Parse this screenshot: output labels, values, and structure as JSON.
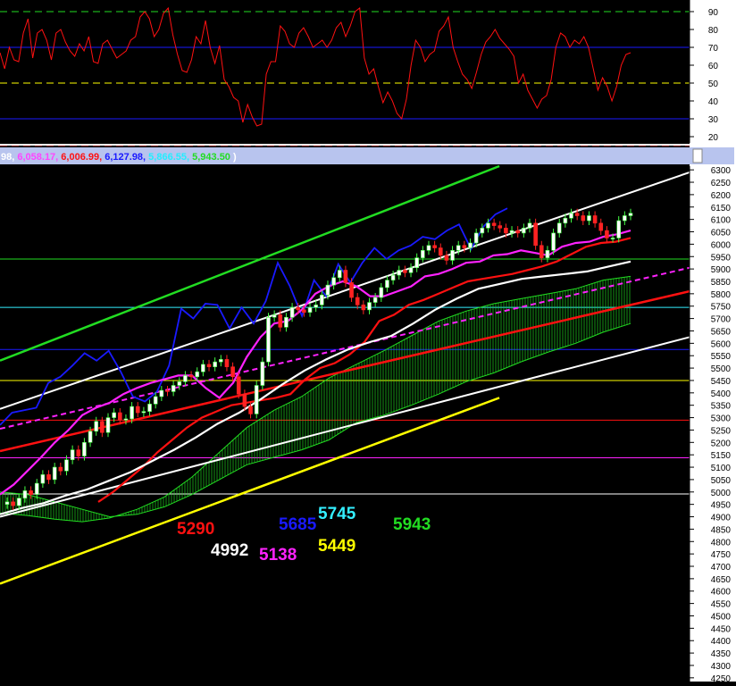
{
  "colors": {
    "background": "#000000",
    "axis_panel": "#ffffff",
    "legend_bar": "#b8c4ee",
    "green": "#22dd22",
    "white": "#ffffff",
    "red": "#ff1111",
    "magenta": "#ff22ff",
    "blue": "#1a1aff",
    "cyan": "#33eeff",
    "yellow": "#ffff00"
  },
  "legend_bar": {
    "open_paren": "(",
    "close_paren": ")",
    "values": [
      {
        "text": "98,",
        "color": "#ffffff"
      },
      {
        "text": "6,058.17,",
        "color": "#ff44ff"
      },
      {
        "text": "6,006.99,",
        "color": "#ff1111"
      },
      {
        "text": "6,127.98,",
        "color": "#1a1aff"
      },
      {
        "text": "5,866.55,",
        "color": "#22eeff"
      },
      {
        "text": "5,943.50",
        "color": "#22dd22"
      }
    ]
  },
  "chart_data": [
    {
      "type": "line",
      "panel": "oscillator",
      "y_ticks": [
        90,
        80,
        70,
        60,
        50,
        40,
        30,
        20
      ],
      "ylim": [
        15,
        95
      ],
      "reference_lines": [
        {
          "value": 90,
          "color": "#22dd22",
          "style": "dashed"
        },
        {
          "value": 70,
          "color": "#1a1aff",
          "style": "solid"
        },
        {
          "value": 50,
          "color": "#ffff00",
          "style": "dashed"
        },
        {
          "value": 30,
          "color": "#1a1aff",
          "style": "solid"
        },
        {
          "value": 15,
          "color": "#ff1111",
          "style": "dashed"
        }
      ],
      "series": [
        {
          "color": "#ff1111",
          "values": [
            67,
            58,
            70,
            63,
            62,
            78,
            86,
            64,
            78,
            80,
            74,
            63,
            78,
            80,
            73,
            68,
            65,
            72,
            68,
            76,
            62,
            61,
            72,
            74,
            69,
            64,
            66,
            68,
            74,
            76,
            87,
            90,
            86,
            76,
            80,
            89,
            92,
            77,
            66,
            57,
            56,
            63,
            76,
            72,
            85,
            70,
            61,
            71,
            52,
            48,
            42,
            40,
            28,
            38,
            31,
            26,
            27,
            55,
            62,
            62,
            82,
            79,
            72,
            70,
            78,
            81,
            76,
            70,
            72,
            74,
            70,
            74,
            81,
            84,
            76,
            82,
            90,
            92,
            64,
            55,
            58,
            48,
            39,
            45,
            40,
            33,
            30,
            41,
            60,
            74,
            70,
            62,
            66,
            68,
            79,
            82,
            87,
            70,
            62,
            55,
            52,
            47,
            56,
            66,
            73,
            76,
            80,
            75,
            72,
            69,
            65,
            50,
            55,
            46,
            41,
            36,
            41,
            43,
            52,
            70,
            78,
            76,
            70,
            74,
            72,
            76,
            70,
            58,
            46,
            53,
            48,
            40,
            48,
            60,
            66,
            67
          ]
        }
      ]
    },
    {
      "type": "line",
      "panel": "price",
      "y_ticks": [
        6300,
        6250,
        6200,
        6150,
        6100,
        6050,
        6000,
        5950,
        5900,
        5850,
        5800,
        5750,
        5700,
        5650,
        5600,
        5550,
        5500,
        5450,
        5400,
        5350,
        5300,
        5250,
        5200,
        5150,
        5100,
        5050,
        5000,
        4950,
        4900,
        4850,
        4800,
        4750,
        4700,
        4650,
        4600,
        4550,
        4500,
        4450,
        4400,
        4350,
        4300,
        4250
      ],
      "ylim": [
        4235,
        6315
      ],
      "price_samples": [
        4960,
        4945,
        4975,
        5005,
        4990,
        5035,
        5070,
        5050,
        5100,
        5085,
        5130,
        5170,
        5145,
        5200,
        5245,
        5285,
        5240,
        5300,
        5320,
        5290,
        5295,
        5345,
        5320,
        5325,
        5355,
        5385,
        5410,
        5405,
        5430,
        5445,
        5470,
        5465,
        5485,
        5515,
        5505,
        5525,
        5535,
        5505,
        5465,
        5395,
        5345,
        5315,
        5430,
        5525,
        5705,
        5715,
        5665,
        5705,
        5745,
        5735,
        5725,
        5745,
        5755,
        5795,
        5835,
        5865,
        5895,
        5845,
        5785,
        5755,
        5735,
        5765,
        5785,
        5825,
        5855,
        5875,
        5895,
        5885,
        5905,
        5945,
        5975,
        5995,
        5985,
        5955,
        5935,
        5975,
        5995,
        5985,
        6005,
        6045,
        6065,
        6085,
        6075,
        6065,
        6045,
        6055,
        6045,
        6065,
        6085,
        5995,
        5945,
        5975,
        6045,
        6085,
        6105,
        6125,
        6115,
        6095,
        6115,
        6085,
        6055,
        6025,
        6025,
        6095,
        6115,
        6125
      ],
      "horizontal_levels": [
        {
          "value": 5940,
          "color": "#22dd22"
        },
        {
          "value": 5745,
          "color": "#33eeff"
        },
        {
          "value": 5575,
          "color": "#1a1aff"
        },
        {
          "value": 5450,
          "color": "#ffff00"
        },
        {
          "value": 5290,
          "color": "#ff1111"
        },
        {
          "value": 5138,
          "color": "#ff22ff"
        },
        {
          "value": 4992,
          "color": "#ffffff"
        }
      ],
      "trend_lines": [
        {
          "color": "#22dd22",
          "from": [
            0,
            5530
          ],
          "to": [
            105,
            6315
          ]
        },
        {
          "color": "#ffffff",
          "from": [
            0,
            5335
          ],
          "to": [
            145,
            6290
          ]
        },
        {
          "color": "#ffffff",
          "from": [
            0,
            4900
          ],
          "to": [
            145,
            5625
          ]
        },
        {
          "color": "#ff1111",
          "from": [
            0,
            5165
          ],
          "to": [
            145,
            5810
          ]
        },
        {
          "color": "#ff22ff",
          "from": [
            0,
            5255
          ],
          "to": [
            145,
            5905
          ],
          "style": "dashed"
        },
        {
          "color": "#ffff00",
          "from": [
            0,
            4630
          ],
          "to": [
            105,
            5380
          ]
        }
      ],
      "series": [
        {
          "color": "#1a1aff",
          "values": [
            5270,
            5320,
            5330,
            5340,
            5440,
            5465,
            5510,
            5560,
            5530,
            5570,
            5485,
            5385,
            5365,
            5405,
            5510,
            5740,
            5700,
            5760,
            5755,
            5660,
            5745,
            5680,
            5770,
            5925,
            5830,
            5710,
            5855,
            5790,
            5920,
            5845,
            5925,
            5985,
            5940,
            5975,
            5995,
            6030,
            6020,
            6055,
            6080,
            5980,
            6070,
            6120,
            6145
          ]
        },
        {
          "color": "#ff22ff",
          "values": [
            4990,
            5030,
            5085,
            5140,
            5200,
            5250,
            5310,
            5340,
            5360,
            5395,
            5420,
            5440,
            5455,
            5470,
            5470,
            5420,
            5380,
            5440,
            5545,
            5625,
            5680,
            5690,
            5735,
            5800,
            5830,
            5850,
            5830,
            5790,
            5790,
            5810,
            5830,
            5870,
            5880,
            5900,
            5925,
            5930,
            5955,
            5960,
            5975,
            5965,
            5955,
            5990,
            6005,
            6010,
            6030,
            6040,
            6055
          ]
        },
        {
          "color": "#ff1111",
          "values": [
            4960,
            5000,
            5050,
            5100,
            5160,
            5210,
            5260,
            5300,
            5325,
            5350,
            5360,
            5370,
            5380,
            5395,
            5455,
            5500,
            5520,
            5555,
            5605,
            5690,
            5715,
            5755,
            5775,
            5800,
            5825,
            5850,
            5860,
            5870,
            5880,
            5895,
            5910,
            5930,
            5960,
            5990,
            6005,
            6010,
            6025
          ]
        },
        {
          "color": "#ffffff",
          "values": [
            4910,
            4935,
            4955,
            4985,
            5010,
            5045,
            5080,
            5125,
            5170,
            5220,
            5275,
            5320,
            5375,
            5435,
            5490,
            5535,
            5575,
            5605,
            5630,
            5680,
            5735,
            5780,
            5820,
            5840,
            5860,
            5870,
            5880,
            5890,
            5910,
            5930
          ]
        }
      ],
      "cloud": {
        "top": [
          4915,
          4905,
          4890,
          4880,
          4895,
          4930,
          4980,
          5060,
          5160,
          5260,
          5330,
          5385,
          5460,
          5515,
          5570,
          5630,
          5690,
          5730,
          5760,
          5780,
          5800,
          5820,
          5855,
          5870
        ],
        "bottom": [
          5000,
          4990,
          4960,
          4930,
          4900,
          4910,
          4940,
          4990,
          5050,
          5110,
          5140,
          5170,
          5210,
          5280,
          5310,
          5350,
          5395,
          5445,
          5480,
          5525,
          5565,
          5600,
          5645,
          5680
        ]
      },
      "value_labels": [
        {
          "text": "5290",
          "color": "#ff1111"
        },
        {
          "text": "4992",
          "color": "#ffffff"
        },
        {
          "text": "5138",
          "color": "#ff22ff"
        },
        {
          "text": "5685",
          "color": "#1a1aff"
        },
        {
          "text": "5745",
          "color": "#33eeff"
        },
        {
          "text": "5449",
          "color": "#ffff00"
        },
        {
          "text": "5943",
          "color": "#22dd22"
        }
      ]
    }
  ]
}
